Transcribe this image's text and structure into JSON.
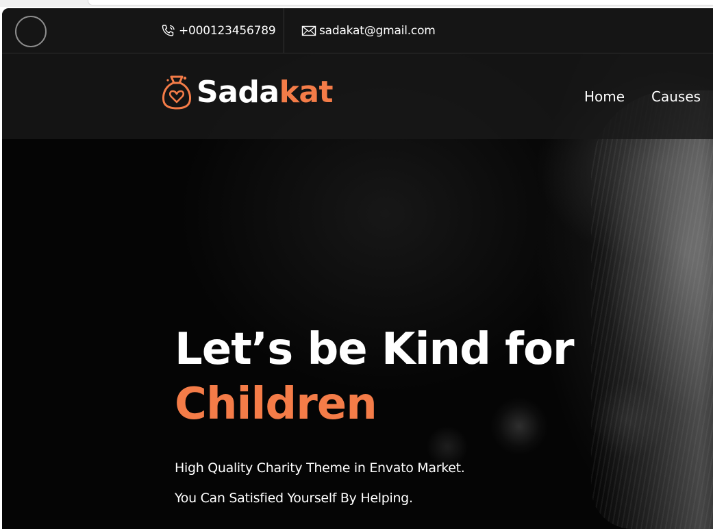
{
  "topbar": {
    "phone": "+000123456789",
    "email": "sadakat@gmail.com",
    "phone_icon": "phone-icon",
    "email_icon": "mail-icon"
  },
  "brand": {
    "name_part1": "Sada",
    "name_part2": "kat",
    "logo_icon": "money-bag-heart-icon"
  },
  "nav": {
    "items": [
      "Home",
      "Causes"
    ]
  },
  "hero": {
    "headline_line1": "Let’s be Kind for",
    "headline_line2": "Children",
    "subtext_line1": "High Quality Charity Theme in Envato Market.",
    "subtext_line2": "You Can Satisfied Yourself By Helping."
  },
  "colors": {
    "accent": "#f47c48",
    "topbar_bg": "#161616",
    "text": "#ffffff"
  }
}
